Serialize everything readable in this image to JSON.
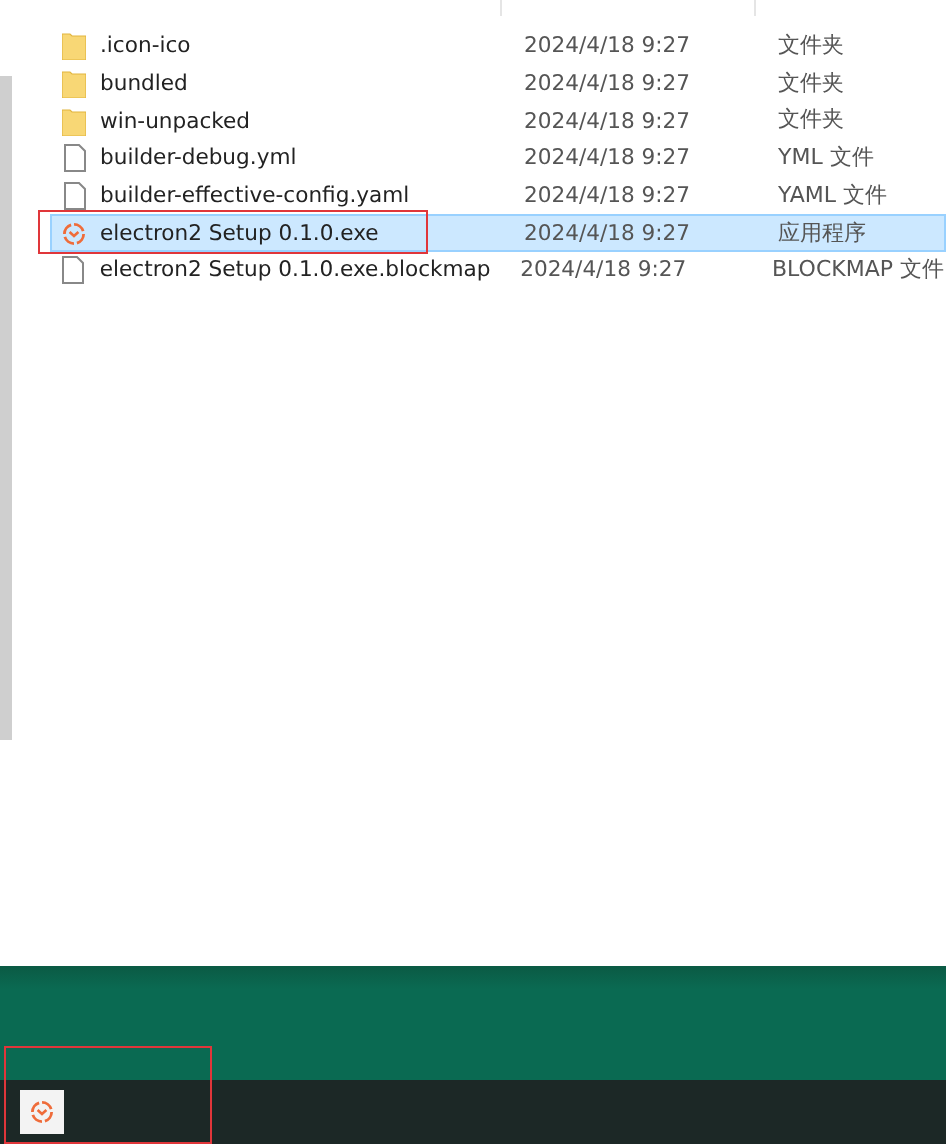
{
  "files": [
    {
      "name": ".icon-ico",
      "date": "2024/4/18 9:27",
      "type": "文件夹",
      "kind": "folder",
      "selected": false,
      "outlined": false
    },
    {
      "name": "bundled",
      "date": "2024/4/18 9:27",
      "type": "文件夹",
      "kind": "folder",
      "selected": false,
      "outlined": false
    },
    {
      "name": "win-unpacked",
      "date": "2024/4/18 9:27",
      "type": "文件夹",
      "kind": "folder",
      "selected": false,
      "outlined": false
    },
    {
      "name": "builder-debug.yml",
      "date": "2024/4/18 9:27",
      "type": "YML 文件",
      "kind": "file",
      "selected": false,
      "outlined": false
    },
    {
      "name": "builder-effective-config.yaml",
      "date": "2024/4/18 9:27",
      "type": "YAML 文件",
      "kind": "file",
      "selected": false,
      "outlined": false
    },
    {
      "name": "electron2 Setup 0.1.0.exe",
      "date": "2024/4/18 9:27",
      "type": "应用程序",
      "kind": "app",
      "selected": true,
      "outlined": true
    },
    {
      "name": "electron2 Setup 0.1.0.exe.blockmap",
      "date": "2024/4/18 9:27",
      "type": "BLOCKMAP 文件",
      "kind": "file",
      "selected": false,
      "outlined": false
    }
  ],
  "taskbar": {
    "apps": [
      {
        "kind": "app",
        "outlined": true
      }
    ]
  }
}
